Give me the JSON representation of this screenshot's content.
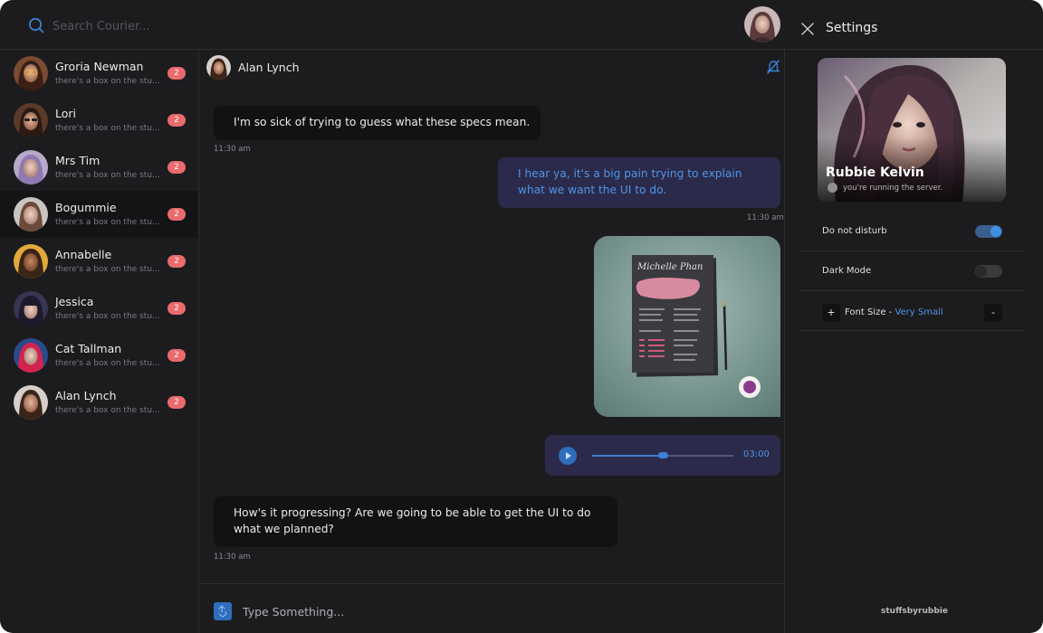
{
  "search": {
    "placeholder": "Search Courier..."
  },
  "contacts": [
    {
      "name": "Groria Newman",
      "preview": "there's a box on the stuff...",
      "unread": "2"
    },
    {
      "name": "Lori",
      "preview": "there's a box on the stuff...",
      "unread": "2"
    },
    {
      "name": "Mrs Tim",
      "preview": "there's a box on the stuff...",
      "unread": "2"
    },
    {
      "name": "Bogummie",
      "preview": "there's a box on the stuff...",
      "unread": "2",
      "active": true
    },
    {
      "name": "Annabelle",
      "preview": "there's a box on the stuff...",
      "unread": "2"
    },
    {
      "name": "Jessica",
      "preview": "there's a box on the stuff...",
      "unread": "2"
    },
    {
      "name": "Cat Tallman",
      "preview": "there's a box on the stuff...",
      "unread": "2"
    },
    {
      "name": "Alan Lynch",
      "preview": "there's a box on the stuff...",
      "unread": "2"
    }
  ],
  "chat": {
    "contact_name": "Alan Lynch",
    "messages": [
      {
        "direction": "incoming",
        "type": "text",
        "text": "I'm so sick of trying to guess what these specs mean.",
        "time": "11:30 am"
      },
      {
        "direction": "outgoing",
        "type": "text",
        "text": "I hear ya, it's a big pain trying to explain what we want the UI to do.",
        "time": "11:30 am"
      },
      {
        "direction": "outgoing",
        "type": "image",
        "image_text": "Michelle Phan"
      },
      {
        "direction": "outgoing",
        "type": "audio",
        "duration": "03:00",
        "progress": 0.5
      },
      {
        "direction": "incoming",
        "type": "text",
        "text": "How's it progressing? Are we going to be able to get the UI to do what we planned?",
        "time": "11:30 am"
      }
    ],
    "composer_placeholder": "Type Something..."
  },
  "settings": {
    "title": "Settings",
    "profile": {
      "name": "Rubbie Kelvin",
      "status": "you're running the server."
    },
    "do_not_disturb": {
      "label": "Do not disturb",
      "enabled": true
    },
    "dark_mode": {
      "label": "Dark Mode",
      "enabled": false
    },
    "font_size": {
      "label": "Font Size - ",
      "value": "Very Small",
      "increase": "+",
      "decrease": "-"
    },
    "brand": "stuffsbyrubbie"
  },
  "colors": {
    "background": "#1c1c1e",
    "accent": "#4f95e8",
    "badge": "#e96b6d",
    "outgoing_bubble": "#2b2a4a",
    "incoming_bubble": "#121214"
  },
  "icons": {
    "search": "search-icon",
    "mute": "bell-off-icon",
    "close": "close-icon",
    "attach": "attach-icon",
    "play": "play-icon",
    "status": "info-icon"
  }
}
